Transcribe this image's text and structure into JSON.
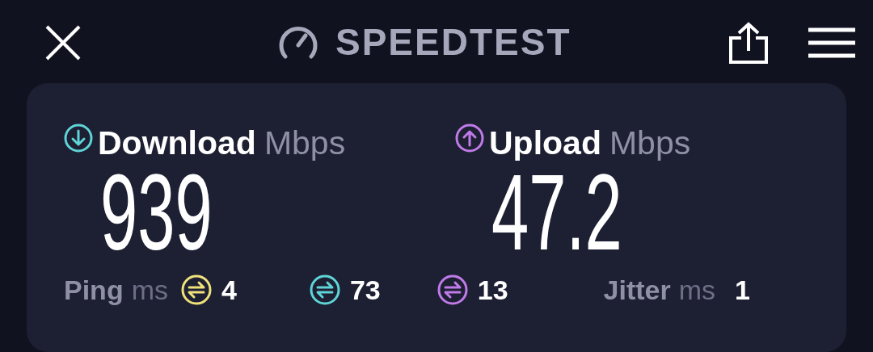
{
  "header": {
    "logo_text": "SPEEDTEST"
  },
  "results": [
    {
      "kind": "download",
      "label": "Download",
      "unit": "Mbps",
      "value": "939",
      "color": "#5fd4d6"
    },
    {
      "kind": "upload",
      "label": "Upload",
      "unit": "Mbps",
      "value": "47.2",
      "color": "#c07be8"
    }
  ],
  "ping": {
    "label": "Ping",
    "unit": "ms",
    "readings": [
      {
        "value": "4",
        "color": "#f0e27a"
      },
      {
        "value": "73",
        "color": "#5fd4d6"
      },
      {
        "value": "13",
        "color": "#c07be8"
      }
    ]
  },
  "jitter": {
    "label": "Jitter",
    "unit": "ms",
    "value": "1"
  }
}
